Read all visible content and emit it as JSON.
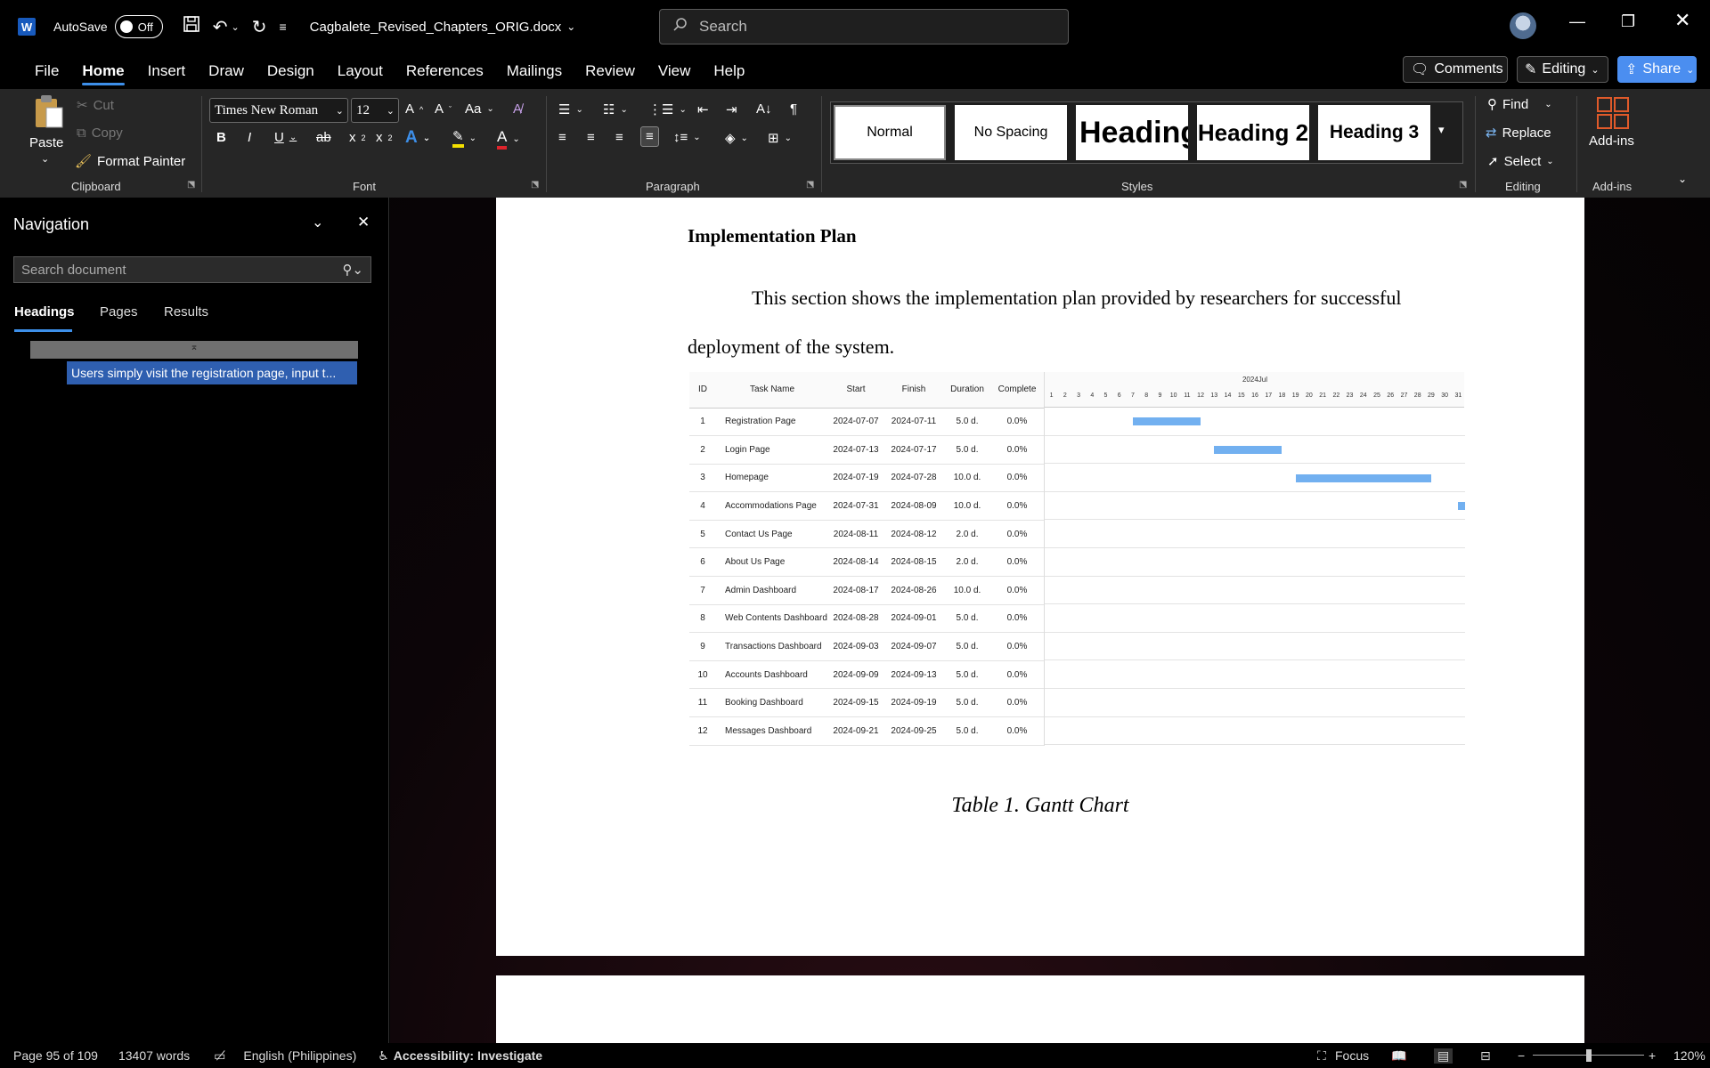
{
  "titlebar": {
    "autosave_label": "AutoSave",
    "autosave_state": "Off",
    "filename": "Cagbalete_Revised_Chapters_ORIG.docx",
    "search_placeholder": "Search"
  },
  "menu": {
    "items": [
      "File",
      "Home",
      "Insert",
      "Draw",
      "Design",
      "Layout",
      "References",
      "Mailings",
      "Review",
      "View",
      "Help"
    ],
    "active": "Home",
    "comments_label": "Comments",
    "editing_label": "Editing",
    "share_label": "Share"
  },
  "ribbon": {
    "clipboard": {
      "paste": "Paste",
      "cut": "Cut",
      "copy": "Copy",
      "format_painter": "Format Painter",
      "label": "Clipboard"
    },
    "font": {
      "name": "Times New Roman",
      "size": "12",
      "label": "Font"
    },
    "paragraph": {
      "label": "Paragraph"
    },
    "styles": {
      "items": [
        "Normal",
        "No Spacing",
        "Heading",
        "Heading 2",
        "Heading 3"
      ],
      "label": "Styles"
    },
    "editing": {
      "find": "Find",
      "replace": "Replace",
      "select": "Select",
      "label": "Editing"
    },
    "addins": {
      "button": "Add-ins",
      "label": "Add-ins"
    }
  },
  "navigation": {
    "title": "Navigation",
    "search_placeholder": "Search document",
    "tabs": [
      "Headings",
      "Pages",
      "Results"
    ],
    "active_tab": "Headings",
    "heading_item": "Users simply visit the registration page, input t..."
  },
  "document": {
    "heading": "Implementation Plan",
    "paragraph_line1": "This section shows the implementation plan provided by researchers for successful",
    "paragraph_line2": "deployment of the system.",
    "caption": "Table 1. Gantt Chart",
    "gantt": {
      "columns": [
        "ID",
        "Task Name",
        "Start",
        "Finish",
        "Duration",
        "Complete"
      ],
      "month_label": "2024Jul",
      "days": [
        "1",
        "2",
        "3",
        "4",
        "5",
        "6",
        "7",
        "8",
        "9",
        "10",
        "11",
        "12",
        "13",
        "14",
        "15",
        "16",
        "17",
        "18",
        "19",
        "20",
        "21",
        "22",
        "23",
        "24",
        "25",
        "26",
        "27",
        "28",
        "29",
        "30",
        "31"
      ],
      "rows": [
        {
          "id": "1",
          "task": "Registration Page",
          "start": "2024-07-07",
          "finish": "2024-07-11",
          "duration": "5.0 d.",
          "complete": "0.0%",
          "bar_start_day": 7,
          "bar_days": 5
        },
        {
          "id": "2",
          "task": "Login Page",
          "start": "2024-07-13",
          "finish": "2024-07-17",
          "duration": "5.0 d.",
          "complete": "0.0%",
          "bar_start_day": 13,
          "bar_days": 5
        },
        {
          "id": "3",
          "task": "Homepage",
          "start": "2024-07-19",
          "finish": "2024-07-28",
          "duration": "10.0 d.",
          "complete": "0.0%",
          "bar_start_day": 19,
          "bar_days": 10
        },
        {
          "id": "4",
          "task": "Accommodations Page",
          "start": "2024-07-31",
          "finish": "2024-08-09",
          "duration": "10.0 d.",
          "complete": "0.0%",
          "bar_start_day": 31,
          "bar_days": 1
        },
        {
          "id": "5",
          "task": "Contact Us Page",
          "start": "2024-08-11",
          "finish": "2024-08-12",
          "duration": "2.0 d.",
          "complete": "0.0%",
          "bar_start_day": 0,
          "bar_days": 0
        },
        {
          "id": "6",
          "task": "About Us Page",
          "start": "2024-08-14",
          "finish": "2024-08-15",
          "duration": "2.0 d.",
          "complete": "0.0%",
          "bar_start_day": 0,
          "bar_days": 0
        },
        {
          "id": "7",
          "task": "Admin Dashboard",
          "start": "2024-08-17",
          "finish": "2024-08-26",
          "duration": "10.0 d.",
          "complete": "0.0%",
          "bar_start_day": 0,
          "bar_days": 0
        },
        {
          "id": "8",
          "task": "Web Contents Dashboard",
          "start": "2024-08-28",
          "finish": "2024-09-01",
          "duration": "5.0 d.",
          "complete": "0.0%",
          "bar_start_day": 0,
          "bar_days": 0
        },
        {
          "id": "9",
          "task": "Transactions Dashboard",
          "start": "2024-09-03",
          "finish": "2024-09-07",
          "duration": "5.0 d.",
          "complete": "0.0%",
          "bar_start_day": 0,
          "bar_days": 0
        },
        {
          "id": "10",
          "task": "Accounts Dashboard",
          "start": "2024-09-09",
          "finish": "2024-09-13",
          "duration": "5.0 d.",
          "complete": "0.0%",
          "bar_start_day": 0,
          "bar_days": 0
        },
        {
          "id": "11",
          "task": "Booking Dashboard",
          "start": "2024-09-15",
          "finish": "2024-09-19",
          "duration": "5.0 d.",
          "complete": "0.0%",
          "bar_start_day": 0,
          "bar_days": 0
        },
        {
          "id": "12",
          "task": "Messages Dashboard",
          "start": "2024-09-21",
          "finish": "2024-09-25",
          "duration": "5.0 d.",
          "complete": "0.0%",
          "bar_start_day": 0,
          "bar_days": 0
        }
      ]
    }
  },
  "statusbar": {
    "page": "Page 95 of 109",
    "words": "13407 words",
    "language": "English (Philippines)",
    "accessibility": "Accessibility: Investigate",
    "focus": "Focus",
    "zoom": "120%",
    "zoom_level": 0.5
  },
  "colors": {
    "accent": "#3d8fe9",
    "share": "#4b8ef0",
    "gantt_bar": "#72b0f0",
    "selection": "#2f5fb0"
  }
}
